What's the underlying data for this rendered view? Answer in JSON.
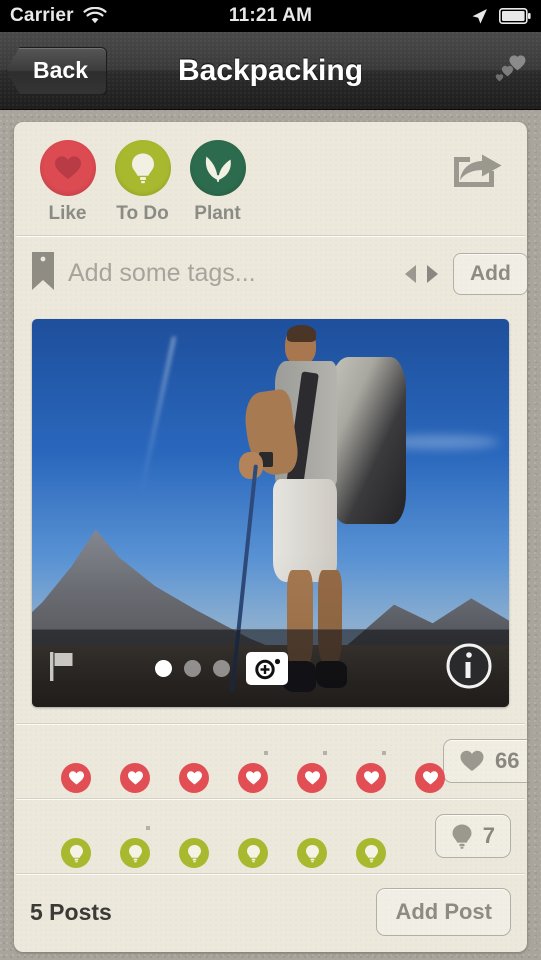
{
  "status_bar": {
    "carrier": "Carrier",
    "time": "11:21 AM",
    "wifi_icon": "wifi-icon",
    "location_icon": "location-arrow-icon",
    "battery_icon": "battery-icon"
  },
  "nav_bar": {
    "back_label": "Back",
    "title": "Backpacking",
    "right_icon": "hearts-icon"
  },
  "actions": {
    "items": [
      {
        "label": "Like",
        "icon": "heart-icon",
        "color": "#dc4a52"
      },
      {
        "label": "To Do",
        "icon": "lightbulb-icon",
        "color": "#a9b92f"
      },
      {
        "label": "Plant",
        "icon": "leaf-icon",
        "color": "#2d6b4e"
      }
    ],
    "share_icon": "share-icon"
  },
  "tags": {
    "icon": "tag-bookmark-icon",
    "value": "",
    "placeholder": "Add some tags...",
    "prev_icon": "arrow-left-icon",
    "next_icon": "arrow-right-icon",
    "add_label": "Add"
  },
  "photo": {
    "alt": "hiker-with-backpack-on-mountain",
    "flag_icon": "flag-icon",
    "camera_icon": "camera-add-icon",
    "info_icon": "info-icon",
    "page_count": 3,
    "page_active": 1
  },
  "likes_row": {
    "badge_icon": "heart-icon",
    "badge_color": "#e14f55",
    "count": "66",
    "count_icon": "heart-icon",
    "avatars": [
      {
        "name": "avatar-1",
        "style": "av-a",
        "placeholder": false
      },
      {
        "name": "avatar-2",
        "style": "av-b",
        "placeholder": false
      },
      {
        "name": "avatar-3",
        "style": "av-c",
        "placeholder": false
      },
      {
        "name": "avatar-4",
        "style": "av-d",
        "placeholder": false
      },
      {
        "name": "avatar-5",
        "style": "",
        "placeholder": true
      },
      {
        "name": "avatar-6",
        "style": "",
        "placeholder": true
      },
      {
        "name": "avatar-7",
        "style": "",
        "placeholder": true
      }
    ]
  },
  "todo_row": {
    "badge_icon": "lightbulb-icon",
    "badge_color": "#a9b92f",
    "count": "7",
    "count_icon": "lightbulb-icon",
    "avatars": [
      {
        "name": "avatar-8",
        "style": "av-e",
        "placeholder": false
      },
      {
        "name": "avatar-9",
        "style": "av-f",
        "placeholder": false
      },
      {
        "name": "avatar-10",
        "style": "",
        "placeholder": true
      },
      {
        "name": "avatar-11",
        "style": "av-g",
        "placeholder": false
      },
      {
        "name": "avatar-12",
        "style": "av-h",
        "placeholder": false
      },
      {
        "name": "avatar-13",
        "style": "av-i",
        "placeholder": false
      }
    ]
  },
  "footer": {
    "posts_count": "5 Posts",
    "add_post_label": "Add Post"
  }
}
